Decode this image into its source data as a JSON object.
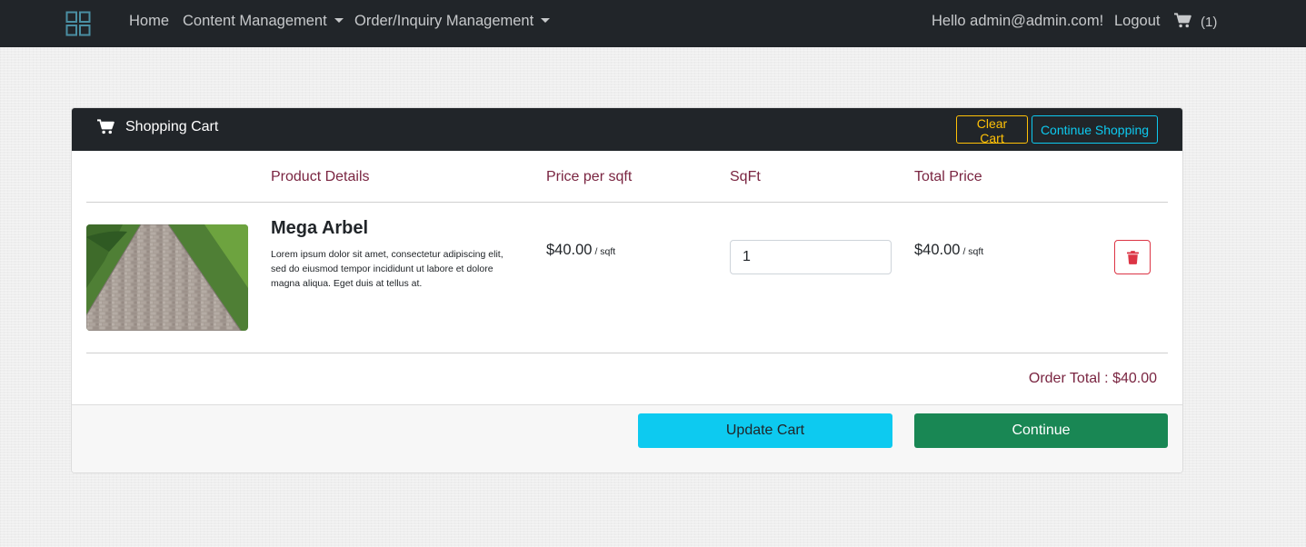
{
  "nav": {
    "home": "Home",
    "content_management": "Content Management",
    "order_management": "Order/Inquiry Management",
    "greeting": "Hello admin@admin.com!",
    "logout": "Logout",
    "cart_count": "(1)"
  },
  "cart": {
    "title": "Shopping Cart",
    "clear_label": "Clear Cart",
    "continue_shopping_label": "Continue Shopping",
    "columns": {
      "product": "Product Details",
      "price": "Price per sqft",
      "sqft": "SqFt",
      "total": "Total Price"
    },
    "items": [
      {
        "name": "Mega Arbel",
        "description": "Lorem ipsum dolor sit amet, consectetur adipiscing elit, sed do eiusmod tempor incididunt ut labore et dolore magna aliqua. Eget duis at tellus at.",
        "price": "$40.00",
        "price_unit": "/ sqft",
        "quantity": "1",
        "total": "$40.00",
        "total_unit": "/ sqft"
      }
    ],
    "order_total": "Order Total : $40.00",
    "update_label": "Update Cart",
    "continue_label": "Continue"
  },
  "icons": {
    "brand": "grid-logo-icon",
    "cart": "cart-icon",
    "delete": "trash-icon"
  },
  "colors": {
    "navbar": "#212529",
    "accent_text": "#7a2541",
    "warning": "#ffc107",
    "info": "#0dcaf0",
    "success": "#198754",
    "danger": "#dc3545"
  }
}
